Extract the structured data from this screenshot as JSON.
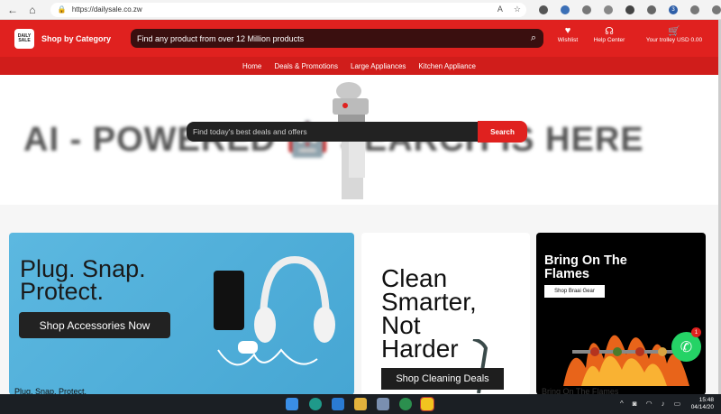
{
  "browser": {
    "url": "https://dailysale.co.zw",
    "ext_badge": "3"
  },
  "header": {
    "logo_text": "DAILY SALE",
    "category_label": "Shop by Category",
    "search_placeholder": "Find any product from over 12 Million products",
    "wishlist": "Wishlist",
    "help": "Help Center",
    "trolley": "Your trolley USD 0.00"
  },
  "menu": [
    "Home",
    "Deals & Promotions",
    "Large Appliances",
    "Kitchen Appliance"
  ],
  "hero": {
    "banner_text": "AI - POWERED 🤖 SEARCH IS HERE",
    "search_placeholder": "Find today's best deals and offers",
    "search_button": "Search"
  },
  "promos": {
    "card1": {
      "title_line1": "Plug. Snap.",
      "title_line2": "Protect.",
      "button": "Shop Accessories Now",
      "caption": "Plug. Snap. Protect."
    },
    "card2": {
      "title_line1": "Clean",
      "title_line2": "Smarter,",
      "title_line3": "Not",
      "title_line4": "Harder",
      "button": "Shop Cleaning Deals"
    },
    "card3": {
      "title_line1": "Bring On The",
      "title_line2": "Flames",
      "button": "Shop Braai Gear",
      "caption": "Bring On The Flames"
    }
  },
  "whatsapp": {
    "badge": "1"
  },
  "taskbar": {
    "time": "15:48",
    "date": "04/14/20"
  },
  "colors": {
    "brand_red": "#e0211f",
    "dark": "#222222",
    "whatsapp": "#25d366"
  }
}
